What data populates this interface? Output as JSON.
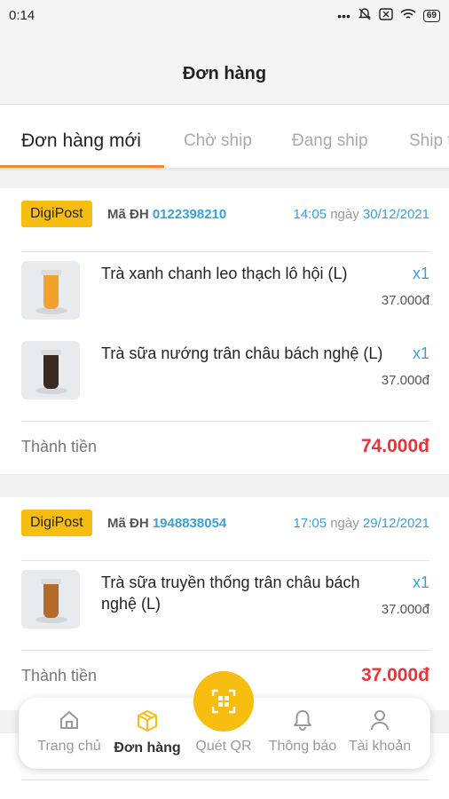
{
  "status_bar": {
    "time": "0:14",
    "battery": "69"
  },
  "header": {
    "title": "Đơn hàng"
  },
  "tabs": [
    {
      "label": "Đơn hàng mới",
      "active": true
    },
    {
      "label": "Chờ ship",
      "active": false
    },
    {
      "label": "Đang ship",
      "active": false
    },
    {
      "label": "Ship t",
      "active": false
    }
  ],
  "orders": [
    {
      "badge": "DigiPost",
      "code_label": "Mã ĐH",
      "code": "0122398210",
      "time": "14:05",
      "date_word": "ngày",
      "date": "30/12/2021",
      "items": [
        {
          "name": "Trà xanh chanh leo thạch lô hội (L)",
          "qty": "x1",
          "price": "37.000đ",
          "cup_color": "#f0a22c"
        },
        {
          "name": "Trà sữa nướng trân châu bách nghệ (L)",
          "qty": "x1",
          "price": "37.000đ",
          "cup_color": "#3a2a22"
        }
      ],
      "total_label": "Thành tiền",
      "total": "74.000đ"
    },
    {
      "badge": "DigiPost",
      "code_label": "Mã ĐH",
      "code": "1948838054",
      "time": "17:05",
      "date_word": "ngày",
      "date": "29/12/2021",
      "items": [
        {
          "name": "Trà sữa truyền thống trân châu bách nghệ (L)",
          "qty": "x1",
          "price": "37.000đ",
          "cup_color": "#b56a2a"
        }
      ],
      "total_label": "Thành tiền",
      "total": "37.000đ"
    }
  ],
  "bottom_nav": {
    "home": "Trang chủ",
    "orders": "Đơn hàng",
    "scan": "Quét QR",
    "notifications": "Thông báo",
    "account": "Tài khoản"
  },
  "colors": {
    "accent": "#f7bd10",
    "tab_underline": "#ef8a2c",
    "link": "#3aa0d8",
    "price": "#e8343a"
  }
}
